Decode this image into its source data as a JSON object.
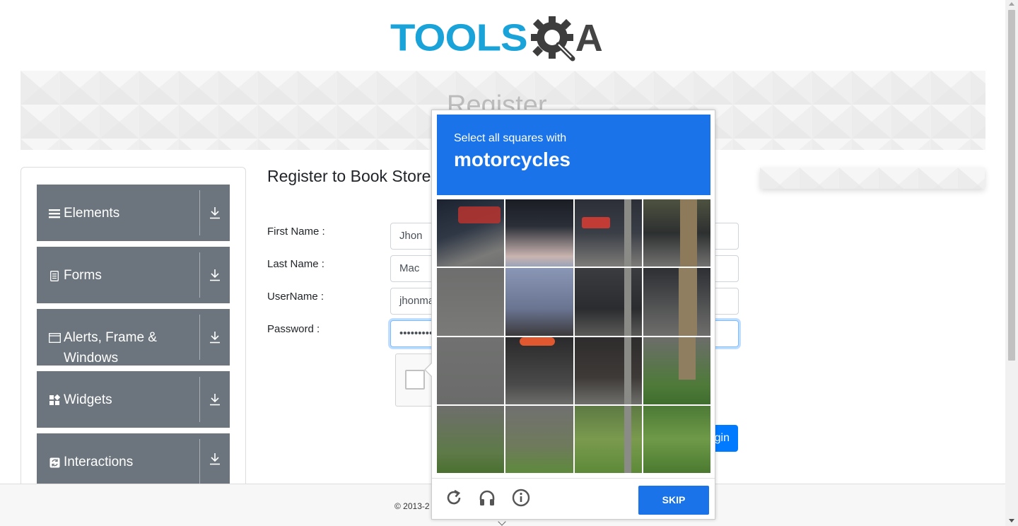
{
  "logo": {
    "text": "TOOLS",
    "suffix": "A"
  },
  "banner": {
    "title": "Register"
  },
  "sidebar": {
    "items": [
      {
        "label": "Elements",
        "icon": "menu-icon"
      },
      {
        "label": "Forms",
        "icon": "document-icon"
      },
      {
        "label": "Alerts, Frame & Windows",
        "icon": "window-icon"
      },
      {
        "label": "Widgets",
        "icon": "widgets-icon"
      },
      {
        "label": "Interactions",
        "icon": "interactions-icon"
      }
    ]
  },
  "form": {
    "title": "Register to Book Store",
    "first_name_label": "First Name :",
    "first_name_value": "Jhon",
    "last_name_label": "Last Name :",
    "last_name_value": "Mac",
    "username_label": "UserName :",
    "username_value": "jhonmac",
    "password_label": "Password :",
    "password_value": "••••••••••",
    "login_label": "gin"
  },
  "footer": {
    "text": "© 2013-2"
  },
  "captcha": {
    "instruction": "Select all squares with",
    "target": "motorcycles",
    "skip_label": "SKIP",
    "icons": [
      "refresh-icon",
      "headphones-icon",
      "info-icon"
    ]
  },
  "colors": {
    "accent": "#1a73e8",
    "sidebar": "#6c757d",
    "logo_blue": "#1aa3d9",
    "primary_button": "#007bff"
  }
}
